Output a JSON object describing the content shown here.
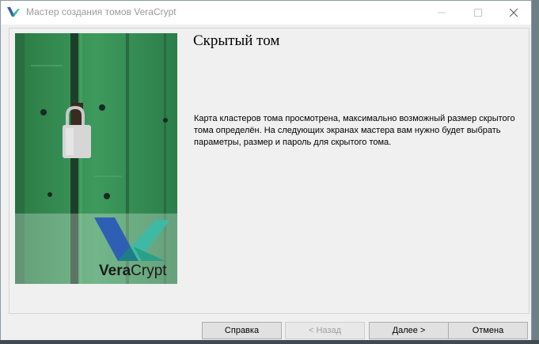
{
  "window": {
    "title": "Мастер создания томов VeraCrypt",
    "icons": [
      "veracrypt-logo-icon",
      "minimize-icon",
      "maximize-icon",
      "close-icon"
    ]
  },
  "banner": {
    "brand_bold": "Vera",
    "brand_regular": "Crypt",
    "image": "padlock-on-green-wooden-door"
  },
  "page": {
    "title": "Скрытый том",
    "description": "Карта кластеров тома просмотрена, максимально возможный размер скрытого тома определён. На следующих экранах мастера вам нужно будет выбрать параметры, размер и пароль для скрытого тома."
  },
  "buttons": {
    "help": "Справка",
    "back": "< Назад",
    "next": "Далее >",
    "cancel": "Отмена"
  },
  "colors": {
    "window_bg": "#f0f0f0",
    "banner_green": "#2f8a4d",
    "logo_blue": "#2f5fb5",
    "logo_teal": "#3fb9a3"
  }
}
